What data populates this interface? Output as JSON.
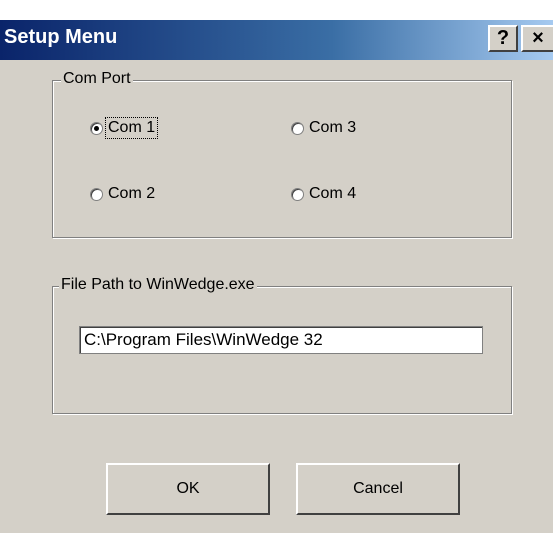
{
  "window": {
    "title": "Setup Menu",
    "help_label": "?",
    "close_label": "×"
  },
  "com_port": {
    "legend": "Com Port",
    "options": [
      {
        "label": "Com 1",
        "selected": true
      },
      {
        "label": "Com 3",
        "selected": false
      },
      {
        "label": "Com 2",
        "selected": false
      },
      {
        "label": "Com 4",
        "selected": false
      }
    ]
  },
  "file_path": {
    "legend": "File Path to WinWedge.exe",
    "value": "C:\\Program Files\\WinWedge 32"
  },
  "buttons": {
    "ok": "OK",
    "cancel": "Cancel"
  }
}
